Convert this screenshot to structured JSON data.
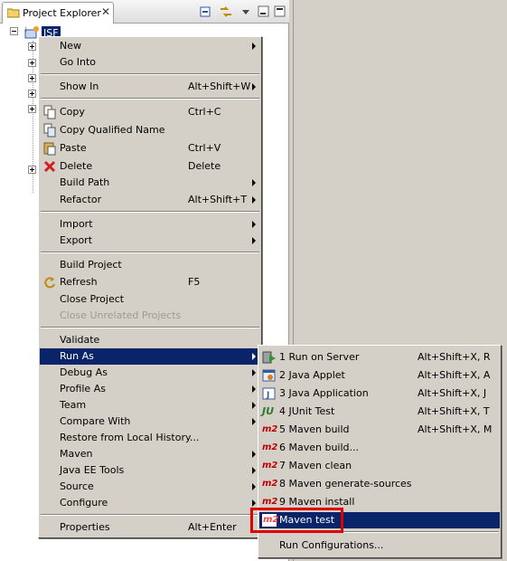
{
  "view": {
    "tab_title": "Project Explorer",
    "close_glyph": "✕",
    "project_label": "JSF"
  },
  "icons": {
    "project-explorer": "folder-icon",
    "collapse-all": "collapse-all-icon",
    "link-editor": "link-with-editor-icon",
    "view-menu": "view-menu-icon",
    "minimize": "minimize-icon",
    "maximize": "maximize-icon"
  },
  "context_menu": {
    "items": [
      {
        "label": "New",
        "accel": "",
        "submenu": true
      },
      {
        "label": "Go Into",
        "accel": "",
        "submenu": false
      },
      {
        "label": "Show In",
        "accel": "Alt+Shift+W",
        "submenu": true
      },
      {
        "label": "Copy",
        "accel": "Ctrl+C",
        "submenu": false
      },
      {
        "label": "Copy Qualified Name",
        "accel": "",
        "submenu": false
      },
      {
        "label": "Paste",
        "accel": "Ctrl+V",
        "submenu": false
      },
      {
        "label": "Delete",
        "accel": "Delete",
        "submenu": false
      },
      {
        "label": "Build Path",
        "accel": "",
        "submenu": true
      },
      {
        "label": "Refactor",
        "accel": "Alt+Shift+T",
        "submenu": true
      },
      {
        "label": "Import",
        "accel": "",
        "submenu": true
      },
      {
        "label": "Export",
        "accel": "",
        "submenu": true
      },
      {
        "label": "Build Project",
        "accel": "",
        "submenu": false
      },
      {
        "label": "Refresh",
        "accel": "F5",
        "submenu": false
      },
      {
        "label": "Close Project",
        "accel": "",
        "submenu": false
      },
      {
        "label": "Close Unrelated Projects",
        "accel": "",
        "submenu": false,
        "disabled": true
      },
      {
        "label": "Validate",
        "accel": "",
        "submenu": false
      },
      {
        "label": "Run As",
        "accel": "",
        "submenu": true,
        "active": true
      },
      {
        "label": "Debug As",
        "accel": "",
        "submenu": true
      },
      {
        "label": "Profile As",
        "accel": "",
        "submenu": true
      },
      {
        "label": "Team",
        "accel": "",
        "submenu": true
      },
      {
        "label": "Compare With",
        "accel": "",
        "submenu": true
      },
      {
        "label": "Restore from Local History...",
        "accel": "",
        "submenu": false
      },
      {
        "label": "Maven",
        "accel": "",
        "submenu": true
      },
      {
        "label": "Java EE Tools",
        "accel": "",
        "submenu": true
      },
      {
        "label": "Source",
        "accel": "",
        "submenu": true
      },
      {
        "label": "Configure",
        "accel": "",
        "submenu": true
      },
      {
        "label": "Properties",
        "accel": "Alt+Enter",
        "submenu": false
      }
    ]
  },
  "run_as_submenu": {
    "m2_badge": "m2",
    "junit_badge": "JU",
    "items": [
      {
        "label": "1 Run on Server",
        "accel": "Alt+Shift+X, R",
        "icon": "run-on-server-icon"
      },
      {
        "label": "2 Java Applet",
        "accel": "Alt+Shift+X, A",
        "icon": "java-applet-icon"
      },
      {
        "label": "3 Java Application",
        "accel": "Alt+Shift+X, J",
        "icon": "java-application-icon"
      },
      {
        "label": "4 JUnit Test",
        "accel": "Alt+Shift+X, T",
        "icon": "junit-icon"
      },
      {
        "label": "5 Maven build",
        "accel": "Alt+Shift+X, M",
        "icon": "maven-icon"
      },
      {
        "label": "6 Maven build...",
        "accel": "",
        "icon": "maven-icon"
      },
      {
        "label": "7 Maven clean",
        "accel": "",
        "icon": "maven-icon"
      },
      {
        "label": "8 Maven generate-sources",
        "accel": "",
        "icon": "maven-icon"
      },
      {
        "label": "9 Maven install",
        "accel": "",
        "icon": "maven-icon"
      },
      {
        "label": "Maven test",
        "accel": "",
        "icon": "maven-icon",
        "active": true
      },
      {
        "label": "Run Configurations...",
        "accel": "",
        "icon": ""
      }
    ]
  },
  "colors": {
    "selection": "#0a246a",
    "menu_bg": "#d4d0c8",
    "highlight_box": "#e00000",
    "maven_badge": "#c00000"
  }
}
